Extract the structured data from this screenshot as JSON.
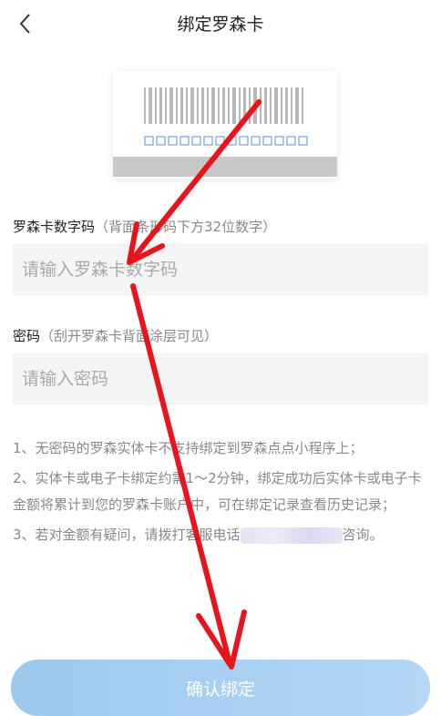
{
  "header": {
    "title": "绑定罗森卡",
    "back_icon": "chevron-left-icon"
  },
  "card_illustration": {
    "icon": "barcode-card-icon"
  },
  "card_number": {
    "label": "罗森卡数字码",
    "hint": "（背面条形码下方32位数字）",
    "placeholder": "请输入罗森卡数字码",
    "value": ""
  },
  "password": {
    "label": "密码",
    "hint": "（刮开罗森卡背面涂层可见）",
    "placeholder": "请输入密码",
    "value": ""
  },
  "notes": {
    "item1": "1、无密码的罗森实体卡不支持绑定到罗森点点小程序上；",
    "item2": "2、实体卡或电子卡绑定约需1～2分钟，绑定成功后实体卡或电子卡金额将累计到您的罗森卡账户中，可在绑定记录查看历史记录；",
    "item3_prefix": "3、若对金额有疑问，请拨打客服电话",
    "item3_suffix": "咨询。"
  },
  "confirm_button": {
    "label": "确认绑定"
  },
  "colors": {
    "button": "#a8d0f2",
    "arrow": "#e8141c",
    "field_bg": "#f4f4f4"
  }
}
